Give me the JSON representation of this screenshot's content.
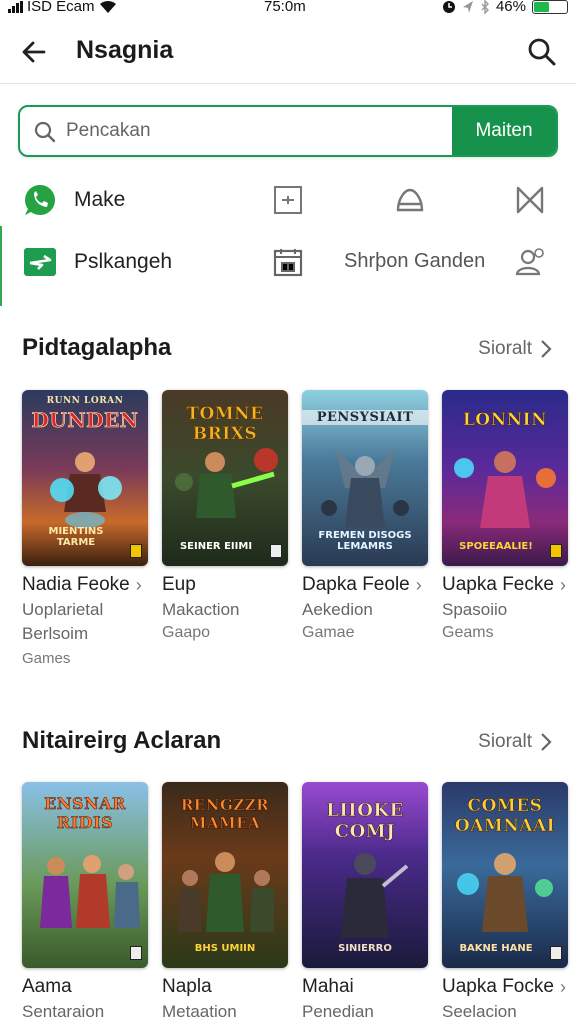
{
  "status_bar": {
    "carrier": "ISD Ecam",
    "time": "75:0m",
    "battery": "46%",
    "battery_level": 0.46,
    "battery_color": "#1fb84c"
  },
  "app_bar": {
    "title": "Nsagnia",
    "back_icon": "back-arrow-icon",
    "search_icon": "search-icon"
  },
  "search": {
    "placeholder": "Pencakan",
    "button_label": "Maiten",
    "accent_color": "#17924c"
  },
  "shortcuts": {
    "row1": {
      "label": "Make",
      "icon": "whatsapp-icon"
    },
    "row2": {
      "label": "Pslkangeh",
      "text": "Shrþon Ganden",
      "icon": "plane-icon"
    }
  },
  "sections": [
    {
      "title": "Pidtagalapha",
      "see_all": "Sioralt",
      "cards": [
        {
          "cover_title": "DUNDEN",
          "cover_top": "RUNN LORAN",
          "cover_bottom": "MIENTINS TARME",
          "name": "Nadia Feoke",
          "chevron": true,
          "sub": "Uoplarietal",
          "sub2": "Berlsoim",
          "sub3": "Games"
        },
        {
          "cover_title": "TOMNE BRIXS",
          "cover_top": "",
          "cover_bottom": "SEINER EIIMI",
          "name": "Eup",
          "chevron": false,
          "sub": "Makaction",
          "sub2": "Gaapo",
          "sub3": ""
        },
        {
          "cover_title": "PENSYSIAIT",
          "cover_top": "",
          "cover_bottom": "FREMEN DISOGS LEMAMRS",
          "name": "Dapka Feole",
          "chevron": true,
          "sub": "Aekedion",
          "sub2": "Gamae",
          "sub3": ""
        },
        {
          "cover_title": "LONNIN",
          "cover_top": "",
          "cover_bottom": "SPOEEAALIE!",
          "name": "Uapka Fecke",
          "chevron": true,
          "sub": "Spasoiio",
          "sub2": "Geams",
          "sub3": ""
        }
      ]
    },
    {
      "title": "Nitaireirg Aclaran",
      "see_all": "Sioralt",
      "cards": [
        {
          "cover_title": "ENSNAR RIDIS",
          "cover_top": "",
          "cover_bottom": "",
          "name": "Aama",
          "chevron": false,
          "sub": "Sentaraion",
          "sub2": "",
          "sub3": ""
        },
        {
          "cover_title": "RENGZZR MAMEA",
          "cover_top": "",
          "cover_bottom": "BHS UMIIN",
          "name": "Napla",
          "chevron": false,
          "sub": "Metaation",
          "sub2": "",
          "sub3": ""
        },
        {
          "cover_title": "LIIOKE COMJ",
          "cover_top": "",
          "cover_bottom": "SINIERRO",
          "name": "Mahai",
          "chevron": false,
          "sub": "Penedian",
          "sub2": "",
          "sub3": ""
        },
        {
          "cover_title": "COMES OAMNAAI",
          "cover_top": "",
          "cover_bottom": "BAKNE HANE",
          "name": "Uapka Focke",
          "chevron": true,
          "sub": "Seelacion",
          "sub2": "",
          "sub3": ""
        }
      ]
    }
  ]
}
